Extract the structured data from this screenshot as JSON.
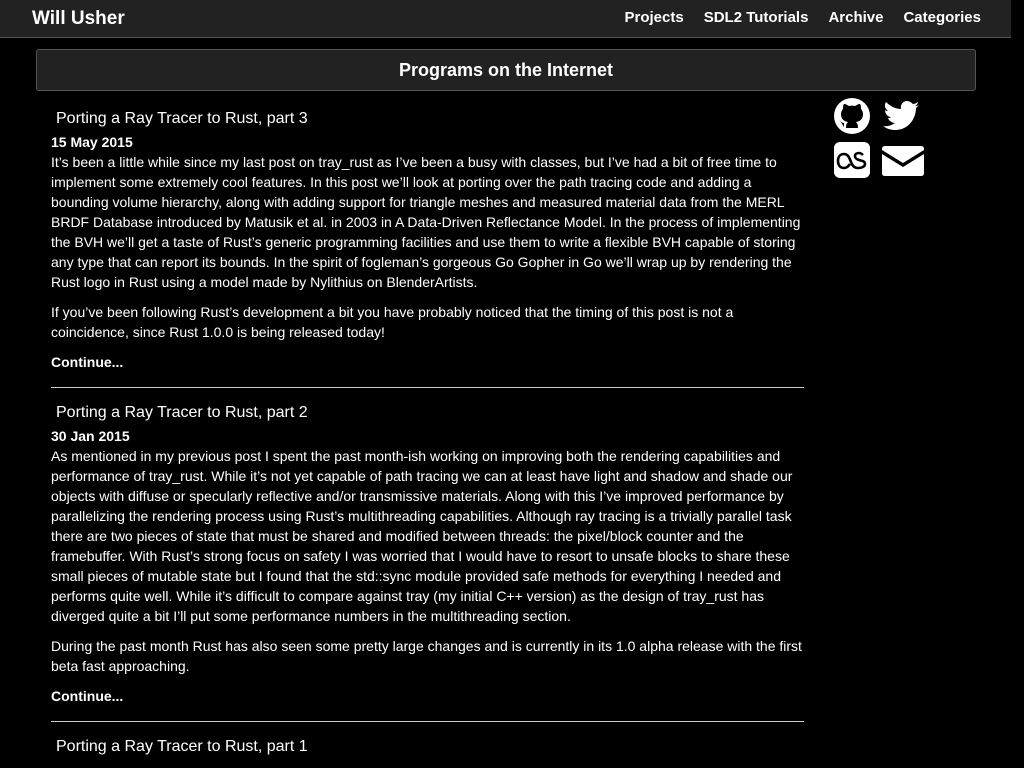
{
  "header": {
    "brand": "Will Usher",
    "nav": [
      "Projects",
      "SDL2 Tutorials",
      "Archive",
      "Categories"
    ]
  },
  "banner": {
    "title": "Programs on the Internet"
  },
  "social": {
    "icons": [
      "github-icon",
      "twitter-icon",
      "lastfm-icon",
      "email-icon"
    ]
  },
  "posts": [
    {
      "title": "Porting a Ray Tracer to Rust, part 3",
      "date": "15 May 2015",
      "paragraphs": [
        "It’s been a little while since my last post on tray_rust as I’ve been a busy with classes, but I’ve had a bit of free time to implement some extremely cool features. In this post we’ll look at porting over the path tracing code and adding a bounding volume hierarchy, along with adding support for triangle meshes and measured material data from the MERL BRDF Database introduced by Matusik et al. in 2003 in A Data-Driven Reflectance Model. In the process of implementing the BVH we’ll get a taste of Rust’s generic programming facilities and use them to write a flexible BVH capable of storing any type that can report its bounds. In the spirit of fogleman’s gorgeous Go Gopher in Go we’ll wrap up by rendering the Rust logo in Rust using a model made by Nylithius on BlenderArtists.",
        "If you’ve been following Rust’s development a bit you have probably noticed that the timing of this post is not a coincidence, since Rust 1.0.0 is being released today!"
      ],
      "continue": "Continue..."
    },
    {
      "title": "Porting a Ray Tracer to Rust, part 2",
      "date": "30 Jan 2015",
      "paragraphs": [
        "As mentioned in my previous post I spent the past month-ish working on improving both the rendering capabilities and performance of tray_rust. While it’s not yet capable of path tracing we can at least have light and shadow and shade our objects with diffuse or specularly reflective and/or transmissive materials. Along with this I’ve improved performance by parallelizing the rendering process using Rust’s multithreading capabilities. Although ray tracing is a trivially parallel task there are two pieces of state that must be shared and modified between threads: the pixel/block counter and the framebuffer. With Rust’s strong focus on safety I was worried that I would have to resort to unsafe blocks to share these small pieces of mutable state but I found that the std::sync module provided safe methods for everything I needed and performs quite well. While it’s difficult to compare against tray (my initial C++ version) as the design of tray_rust has diverged quite a bit I’ll put some performance numbers in the multithreading section.",
        "During the past month Rust has also seen some pretty large changes and is currently in its 1.0 alpha release with the first beta fast approaching."
      ],
      "continue": "Continue..."
    },
    {
      "title": "Porting a Ray Tracer to Rust, part 1"
    }
  ]
}
